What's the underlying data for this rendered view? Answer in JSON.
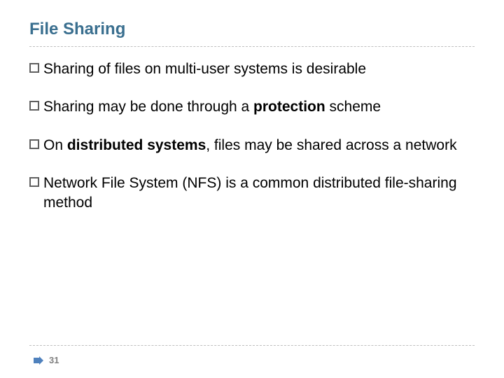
{
  "title": "File Sharing",
  "bullets": [
    {
      "runs": [
        {
          "t": "Sharing of files on multi-user systems is desirable"
        }
      ]
    },
    {
      "runs": [
        {
          "t": "Sharing may be done through a "
        },
        {
          "t": "protection",
          "b": true
        },
        {
          "t": " scheme"
        }
      ]
    },
    {
      "runs": [
        {
          "t": "On "
        },
        {
          "t": "distributed systems",
          "b": true
        },
        {
          "t": ", files may be shared across a network"
        }
      ]
    },
    {
      "runs": [
        {
          "t": "Network File System (NFS) is a common distributed file-sharing method"
        }
      ]
    }
  ],
  "pageNumber": "31",
  "colors": {
    "title": "#3a6f8f",
    "divider": "#bfbfbf",
    "arrow": "#4f81bd"
  }
}
